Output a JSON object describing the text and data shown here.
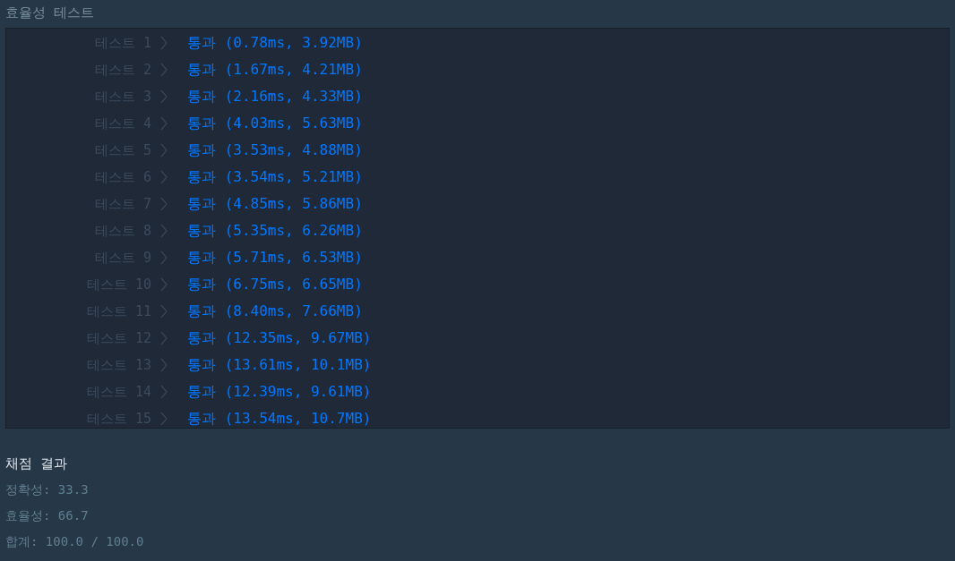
{
  "section_title": "효율성  테스트",
  "tests": [
    {
      "label": "테스트 1",
      "result": "통과 (0.78ms, 3.92MB)"
    },
    {
      "label": "테스트 2",
      "result": "통과 (1.67ms, 4.21MB)"
    },
    {
      "label": "테스트 3",
      "result": "통과 (2.16ms, 4.33MB)"
    },
    {
      "label": "테스트 4",
      "result": "통과 (4.03ms, 5.63MB)"
    },
    {
      "label": "테스트 5",
      "result": "통과 (3.53ms, 4.88MB)"
    },
    {
      "label": "테스트 6",
      "result": "통과 (3.54ms, 5.21MB)"
    },
    {
      "label": "테스트 7",
      "result": "통과 (4.85ms, 5.86MB)"
    },
    {
      "label": "테스트 8",
      "result": "통과 (5.35ms, 6.26MB)"
    },
    {
      "label": "테스트 9",
      "result": "통과 (5.71ms, 6.53MB)"
    },
    {
      "label": "테스트 10",
      "result": "통과 (6.75ms, 6.65MB)"
    },
    {
      "label": "테스트 11",
      "result": "통과 (8.40ms, 7.66MB)"
    },
    {
      "label": "테스트 12",
      "result": "통과 (12.35ms, 9.67MB)"
    },
    {
      "label": "테스트 13",
      "result": "통과 (13.61ms, 10.1MB)"
    },
    {
      "label": "테스트 14",
      "result": "통과 (12.39ms, 9.61MB)"
    },
    {
      "label": "테스트 15",
      "result": "통과 (13.54ms, 10.7MB)"
    }
  ],
  "grading": {
    "title": "채점 결과",
    "lines": [
      "정확성: 33.3",
      "효율성: 66.7",
      "합계: 100.0 / 100.0"
    ]
  }
}
